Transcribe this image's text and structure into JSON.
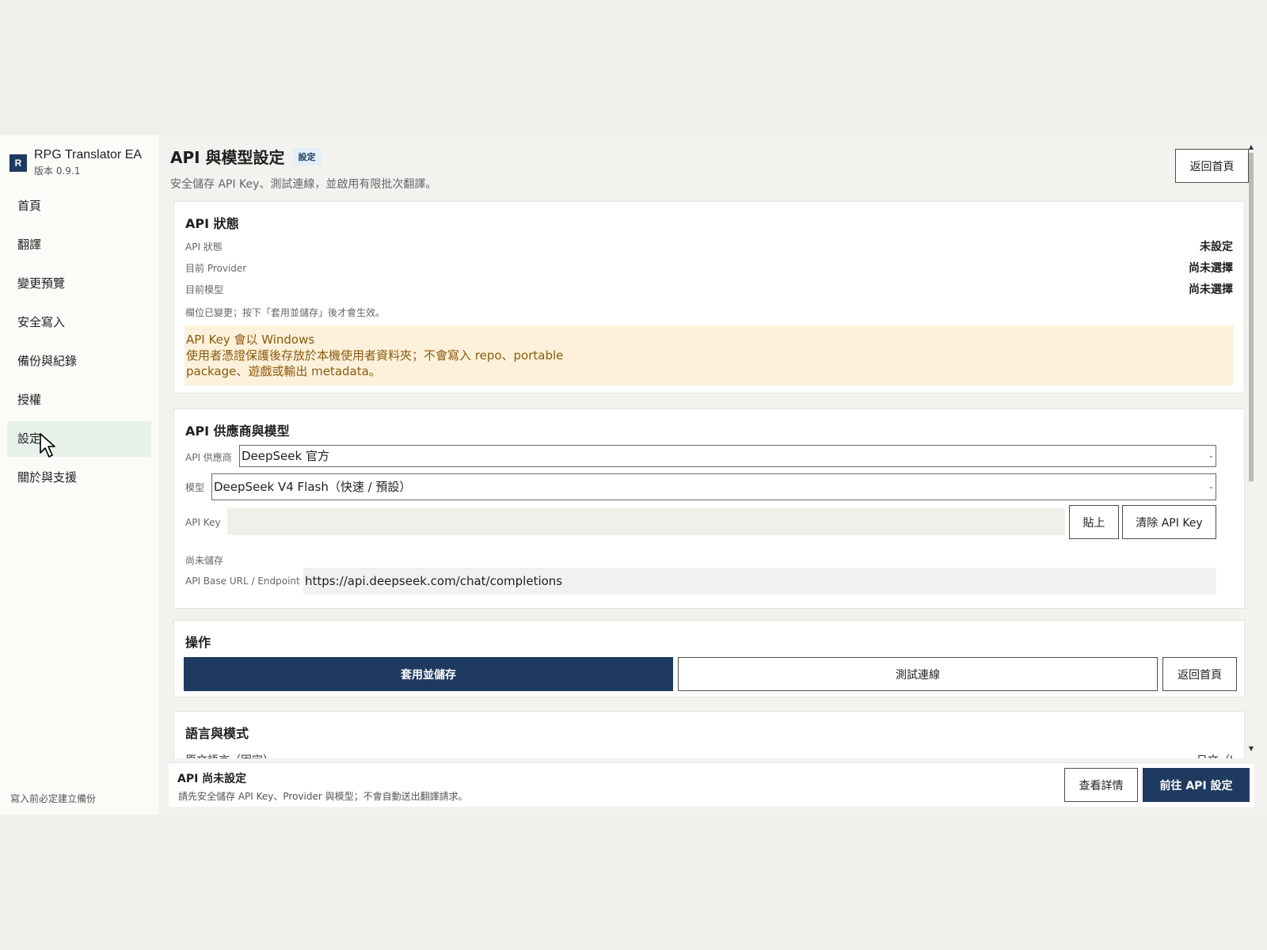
{
  "app": {
    "brand_mark": "R",
    "name": "RPG Translator EA",
    "version": "版本 0.9.1"
  },
  "sidebar": {
    "items": [
      {
        "label": "首頁"
      },
      {
        "label": "翻譯"
      },
      {
        "label": "變更預覽"
      },
      {
        "label": "安全寫入"
      },
      {
        "label": "備份與紀錄"
      },
      {
        "label": "授權"
      },
      {
        "label": "設定"
      },
      {
        "label": "關於與支援"
      }
    ],
    "active_label": "設定",
    "footer": "寫入前必定建立備份"
  },
  "header": {
    "title": "API 與模型設定",
    "badge": "設定",
    "subtitle": "安全儲存 API Key、測試連線，並啟用有限批次翻譯。",
    "home_button": "返回首頁"
  },
  "status_card": {
    "title": "API 狀態",
    "rows": [
      {
        "label": "API 狀態",
        "value": "未設定"
      },
      {
        "label": "目前 Provider",
        "value": "尚未選擇"
      },
      {
        "label": "目前模型",
        "value": "尚未選擇"
      }
    ],
    "note": "欄位已變更；按下「套用並儲存」後才會生效。",
    "warning_lines": [
      "API Key 會以 Windows",
      "使用者憑證保護後存放於本機使用者資料夾；不會寫入 repo、portable",
      "package、遊戲或輸出 metadata。"
    ]
  },
  "provider_card": {
    "title": "API 供應商與模型",
    "provider_label": "API 供應商",
    "provider_value": "DeepSeek 官方",
    "model_label": "模型",
    "model_value": "DeepSeek V4 Flash（快速 / 預設）",
    "apikey_label": "API Key",
    "apikey_value": "",
    "paste_button": "貼上",
    "clear_button": "清除 API Key",
    "save_state": "尚未儲存",
    "endpoint_label": "API Base URL / Endpoint",
    "endpoint_value": "https://api.deepseek.com/chat/completions"
  },
  "actions_card": {
    "title": "操作",
    "apply_button": "套用並儲存",
    "test_button": "測試連線",
    "home_button": "返回首頁"
  },
  "language_card": {
    "title": "語言與模式",
    "partial_row_label": "原文語言（固定）",
    "partial_row_value": "日文（J"
  },
  "bottom_bar": {
    "title": "API 尚未設定",
    "description": "請先安全儲存 API Key、Provider 與模型；不會自動送出翻譯請求。",
    "details_button": "查看詳情",
    "goto_button": "前往 API 設定"
  },
  "colors": {
    "primary": "#1e3a5f",
    "active_nav": "#e8f1e9",
    "warning_bg": "#fdf1dc",
    "warning_text": "#8a5a0b"
  },
  "icons": {
    "chevron": "chevron-down-icon",
    "cursor": "mouse-pointer-icon"
  }
}
